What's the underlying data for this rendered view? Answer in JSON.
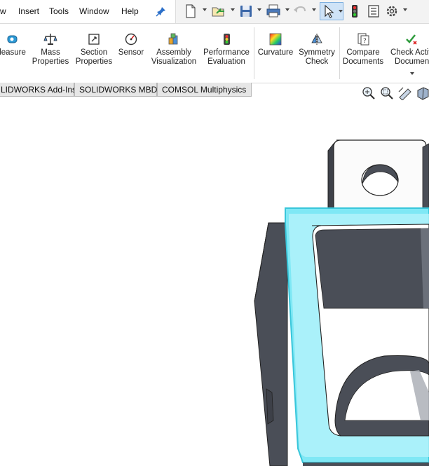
{
  "menubar": {
    "items": [
      "w",
      "Insert",
      "Tools",
      "Window",
      "Help"
    ],
    "pin_icon": "pin-icon"
  },
  "quick_access": {
    "icons": [
      "new-document-icon",
      "open-icon",
      "save-icon",
      "print-icon",
      "undo-icon",
      "select-arrow-icon",
      "rebuild-traffic-light-icon",
      "file-properties-icon",
      "options-gear-icon"
    ]
  },
  "ribbon": {
    "buttons": [
      {
        "line1": "leasure",
        "line2": "",
        "icon": "measure-icon"
      },
      {
        "line1": "Mass",
        "line2": "Properties",
        "icon": "mass-properties-icon"
      },
      {
        "line1": "Section",
        "line2": "Properties",
        "icon": "section-properties-icon"
      },
      {
        "line1": "Sensor",
        "line2": "",
        "icon": "sensor-icon"
      },
      {
        "line1": "Assembly",
        "line2": "Visualization",
        "icon": "assembly-visualization-icon"
      },
      {
        "line1": "Performance",
        "line2": "Evaluation",
        "icon": "performance-evaluation-icon"
      },
      {
        "line1": "Curvature",
        "line2": "",
        "icon": "curvature-icon"
      },
      {
        "line1": "Symmetry",
        "line2": "Check",
        "icon": "symmetry-check-icon"
      },
      {
        "line1": "Compare",
        "line2": "Documents",
        "icon": "compare-documents-icon"
      },
      {
        "line1": "Check Activ",
        "line2": "Documen",
        "icon": "check-active-document-icon"
      }
    ]
  },
  "tabs": [
    "LIDWORKS Add-Ins",
    "SOLIDWORKS MBD",
    "COMSOL Multiphysics"
  ],
  "view_toolbar": {
    "icons": [
      "zoom-to-fit-icon",
      "zoom-to-area-icon",
      "previous-view-icon",
      "section-view-icon"
    ]
  },
  "colors": {
    "selection_highlight": "#7fe8f5",
    "part_face_dark": "#4a4e57",
    "part_face_light": "#fdfdfd",
    "background": "#ffffff"
  }
}
